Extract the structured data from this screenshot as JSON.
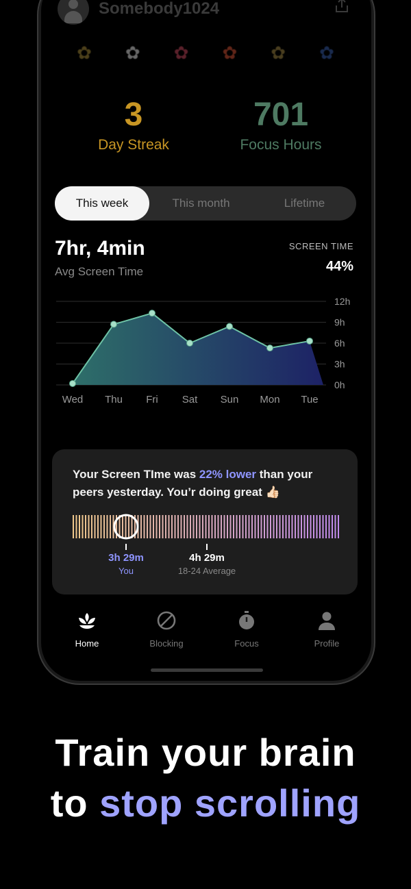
{
  "user": {
    "name": "Somebody1024"
  },
  "stats": {
    "streak_value": "3",
    "streak_label": "Day Streak",
    "focus_value": "701",
    "focus_label": "Focus Hours"
  },
  "tabs": [
    "This week",
    "This month",
    "Lifetime"
  ],
  "summary": {
    "avg_time": "7hr, 4min",
    "avg_label": "Avg Screen Time",
    "screen_time_label": "SCREEN TIME",
    "screen_time_value": "44%"
  },
  "chart_data": {
    "type": "area",
    "categories": [
      "Wed",
      "Thu",
      "Fri",
      "Sat",
      "Sun",
      "Mon",
      "Tue"
    ],
    "values": [
      0.2,
      8.7,
      10.3,
      6.0,
      8.4,
      5.3,
      6.3
    ],
    "y_ticks": [
      "12h",
      "9h",
      "6h",
      "3h",
      "0h"
    ],
    "ylim": [
      0,
      12
    ],
    "grid": true
  },
  "card": {
    "text_before": "Your Screen TIme was ",
    "highlight": "22% lower",
    "text_after": " than your peers yesterday. You’r doing great 👍🏻",
    "you_value": "3h 29m",
    "you_label": "You",
    "avg_value": "4h 29m",
    "avg_label": "18-24 Average",
    "you_position": 0.2
  },
  "nav": [
    {
      "label": "Home",
      "icon": "lotus-icon"
    },
    {
      "label": "Blocking",
      "icon": "block-icon"
    },
    {
      "label": "Focus",
      "icon": "stopwatch-icon"
    },
    {
      "label": "Profile",
      "icon": "person-icon"
    }
  ],
  "tagline": {
    "line1": "Train your brain",
    "line2_a": "to ",
    "line2_b": "stop scrolling"
  },
  "colors": {
    "streak": "#c89624",
    "focus": "#4e7a62",
    "accent": "#9fa3ff",
    "chart_line": "#6ec3a6"
  }
}
